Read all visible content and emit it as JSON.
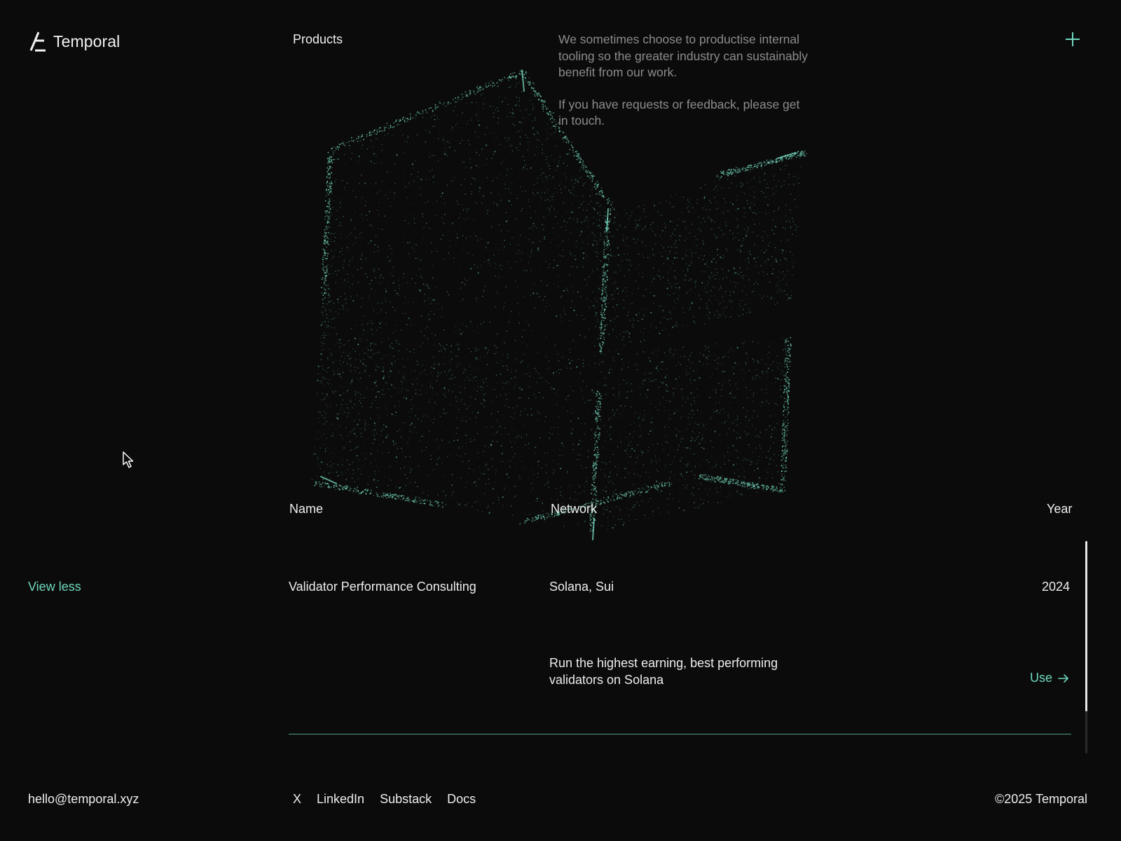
{
  "brand": {
    "name": "Temporal",
    "logo_icon": "temporal-logo-icon"
  },
  "header": {
    "nav_label": "Products",
    "intro_p1": "We sometimes choose to productise internal tooling so the greater industry can sustainably benefit from our work.",
    "intro_p2": "If you have requests or feedback, please get in touch.",
    "plus_icon": "plus-icon"
  },
  "table": {
    "headers": {
      "name": "Name",
      "network": "Network",
      "year": "Year"
    },
    "rows": [
      {
        "name": "Validator Performance Consulting",
        "network": "Solana, Sui",
        "year": "2024",
        "description": "Run the highest earning, best performing validators on Solana",
        "action_label": "Use",
        "action_icon": "arrow-right-icon"
      }
    ]
  },
  "sidebar": {
    "toggle_label": "View less"
  },
  "footer": {
    "email": "hello@temporal.xyz",
    "links": [
      "X",
      "LinkedIn",
      "Substack",
      "Docs"
    ],
    "copyright": "©2025 Temporal"
  },
  "colors": {
    "background": "#0b0b0b",
    "accent": "#6fd6bd",
    "text": "#ededed",
    "muted": "#8c8c8c"
  }
}
